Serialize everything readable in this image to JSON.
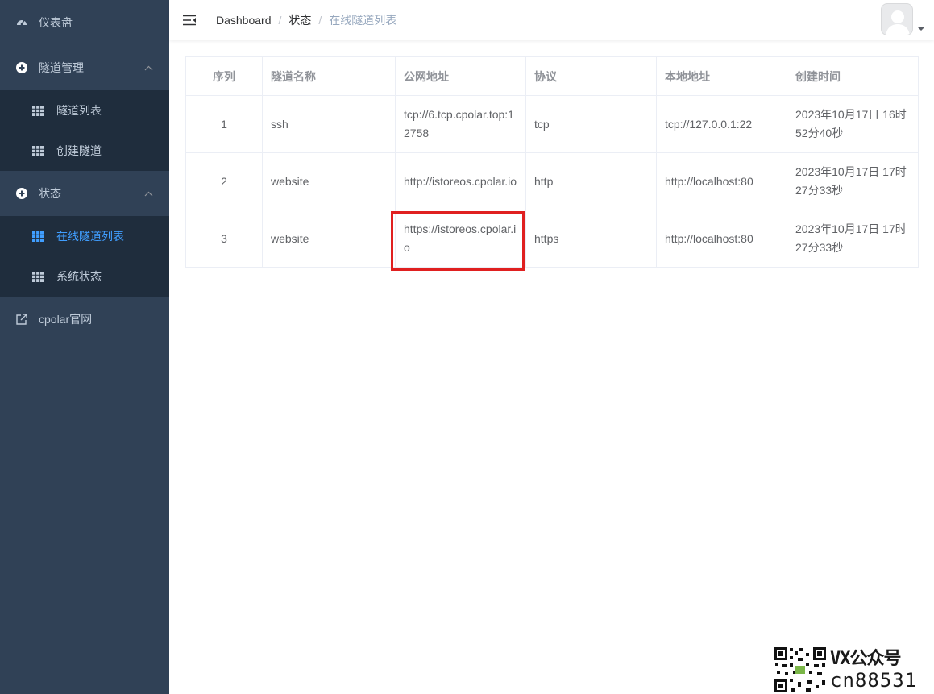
{
  "sidebar": {
    "dashboard": {
      "label": "仪表盘",
      "icon": "dashboard-icon"
    },
    "tunnel_mgmt": {
      "label": "隧道管理",
      "icon": "plus-circle-icon",
      "items": [
        {
          "label": "隧道列表",
          "icon": "table-icon"
        },
        {
          "label": "创建隧道",
          "icon": "table-icon"
        }
      ]
    },
    "status": {
      "label": "状态",
      "icon": "plus-circle-icon",
      "items": [
        {
          "label": "在线隧道列表",
          "icon": "table-icon",
          "active": true
        },
        {
          "label": "系统状态",
          "icon": "table-icon"
        }
      ]
    },
    "website": {
      "label": "cpolar官网",
      "icon": "external-link-icon"
    }
  },
  "header": {
    "breadcrumb": [
      "Dashboard",
      "状态",
      "在线隧道列表"
    ],
    "separator": "/"
  },
  "table": {
    "columns": [
      "序列",
      "隧道名称",
      "公网地址",
      "协议",
      "本地地址",
      "创建时间"
    ],
    "rows": [
      [
        "1",
        "ssh",
        "tcp://6.tcp.cpolar.top:12758",
        "tcp",
        "tcp://127.0.0.1:22",
        "2023年10月17日 16时52分40秒"
      ],
      [
        "2",
        "website",
        "http://istoreos.cpolar.io",
        "http",
        "http://localhost:80",
        "2023年10月17日 17时27分33秒"
      ],
      [
        "3",
        "website",
        "https://istoreos.cpolar.io",
        "https",
        "http://localhost:80",
        "2023年10月17日 17时27分33秒"
      ]
    ]
  },
  "watermark": {
    "line1": "VX公众号",
    "line2": "cn88531"
  },
  "colors": {
    "sidebar_bg": "#304156",
    "submenu_bg": "#1f2d3d",
    "active": "#409eff",
    "highlight": "#e02020"
  }
}
